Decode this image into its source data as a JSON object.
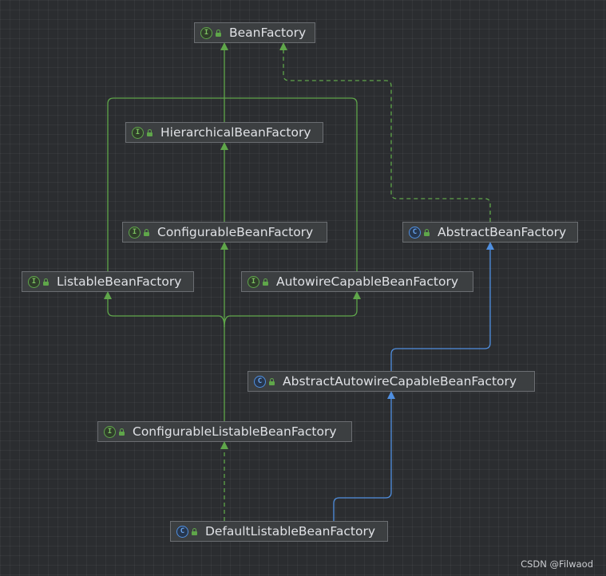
{
  "colors": {
    "implements": "#5fa64a",
    "extends": "#4f8fe0",
    "background": "#2b2d30",
    "node_fill": "#3c3f41",
    "node_border": "#6b6e72",
    "text": "#dfe1e5"
  },
  "nodes": {
    "bean_factory": {
      "label": "BeanFactory",
      "kind": "interface",
      "badge": "I"
    },
    "hierarchical_bean_factory": {
      "label": "HierarchicalBeanFactory",
      "kind": "interface",
      "badge": "I"
    },
    "configurable_bean_factory": {
      "label": "ConfigurableBeanFactory",
      "kind": "interface",
      "badge": "I"
    },
    "abstract_bean_factory": {
      "label": "AbstractBeanFactory",
      "kind": "class",
      "badge": "C"
    },
    "listable_bean_factory": {
      "label": "ListableBeanFactory",
      "kind": "interface",
      "badge": "I"
    },
    "autowire_capable_bean_factory": {
      "label": "AutowireCapableBeanFactory",
      "kind": "interface",
      "badge": "I"
    },
    "abstract_autowire_capable_bean_factory": {
      "label": "AbstractAutowireCapableBeanFactory",
      "kind": "class",
      "badge": "C"
    },
    "configurable_listable_bean_factory": {
      "label": "ConfigurableListableBeanFactory",
      "kind": "interface",
      "badge": "I"
    },
    "default_listable_bean_factory": {
      "label": "DefaultListableBeanFactory",
      "kind": "class",
      "badge": "C"
    }
  },
  "edges": [
    {
      "from": "hierarchical_bean_factory",
      "to": "bean_factory",
      "kind": "extends-interface",
      "style": "solid"
    },
    {
      "from": "listable_bean_factory",
      "to": "bean_factory",
      "kind": "extends-interface",
      "style": "solid"
    },
    {
      "from": "autowire_capable_bean_factory",
      "to": "bean_factory",
      "kind": "extends-interface",
      "style": "solid"
    },
    {
      "from": "abstract_bean_factory",
      "to": "bean_factory",
      "kind": "implements",
      "style": "dashed"
    },
    {
      "from": "configurable_bean_factory",
      "to": "hierarchical_bean_factory",
      "kind": "extends-interface",
      "style": "solid"
    },
    {
      "from": "configurable_listable_bean_factory",
      "to": "listable_bean_factory",
      "kind": "extends-interface",
      "style": "solid"
    },
    {
      "from": "configurable_listable_bean_factory",
      "to": "autowire_capable_bean_factory",
      "kind": "extends-interface",
      "style": "solid"
    },
    {
      "from": "configurable_listable_bean_factory",
      "to": "configurable_bean_factory",
      "kind": "extends-interface",
      "style": "solid"
    },
    {
      "from": "abstract_autowire_capable_bean_factory",
      "to": "abstract_bean_factory",
      "kind": "extends-class",
      "style": "solid"
    },
    {
      "from": "default_listable_bean_factory",
      "to": "abstract_autowire_capable_bean_factory",
      "kind": "extends-class",
      "style": "solid"
    },
    {
      "from": "default_listable_bean_factory",
      "to": "configurable_listable_bean_factory",
      "kind": "implements",
      "style": "dashed"
    }
  ],
  "watermark": "CSDN @Filwaod"
}
